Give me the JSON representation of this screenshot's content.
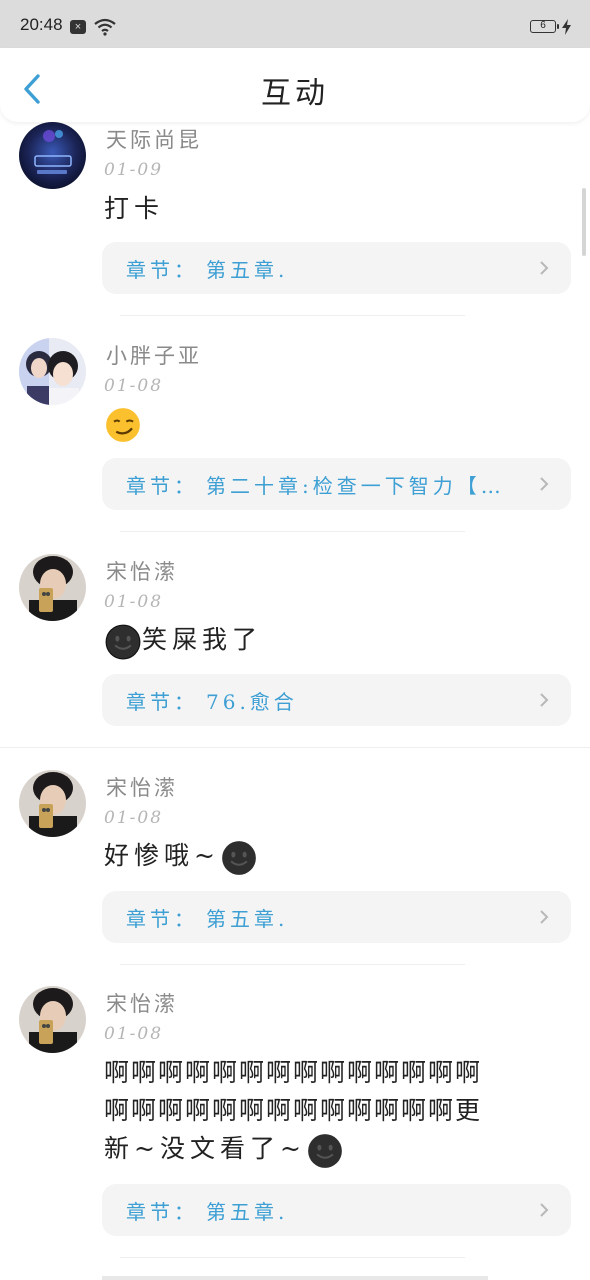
{
  "status_bar": {
    "time": "20:48",
    "notification_icon": "close-square-icon",
    "battery_level": "6"
  },
  "header": {
    "title": "互动",
    "back_icon": "chevron-left-icon"
  },
  "colors": {
    "accent": "#3d9fd4",
    "chapter_card_bg": "#f4f4f4",
    "username": "#8a8a8a",
    "date": "#b5b5b5"
  },
  "chapter_prefix": "章节：",
  "comments": [
    {
      "username": "天际尚昆",
      "date": "01-09",
      "content": "打卡",
      "chapter": "第五章."
    },
    {
      "username": "小胖子亚",
      "date": "01-08",
      "content": "",
      "content_emoji": "smirking-face-emoji",
      "chapter": "第二十章:检查一下智力【…"
    },
    {
      "username": "宋怡潆",
      "date": "01-08",
      "content": "笑屎我了",
      "content_emoji": "dark-smiley-face-emoji",
      "chapter": "76.愈合"
    },
    {
      "username": "宋怡潆",
      "date": "01-08",
      "content": "好惨哦~",
      "content_emoji": "dark-smiley-face-emoji",
      "chapter": "第五章."
    },
    {
      "username": "宋怡潆",
      "date": "01-08",
      "content_line1": "啊啊啊啊啊啊啊啊啊啊啊啊啊啊",
      "content_line2": "啊啊啊啊啊啊啊啊啊啊啊啊啊更",
      "content_line3": "新~没文看了~",
      "content_emoji": "dark-smiley-face-emoji",
      "chapter": "第五章."
    }
  ]
}
